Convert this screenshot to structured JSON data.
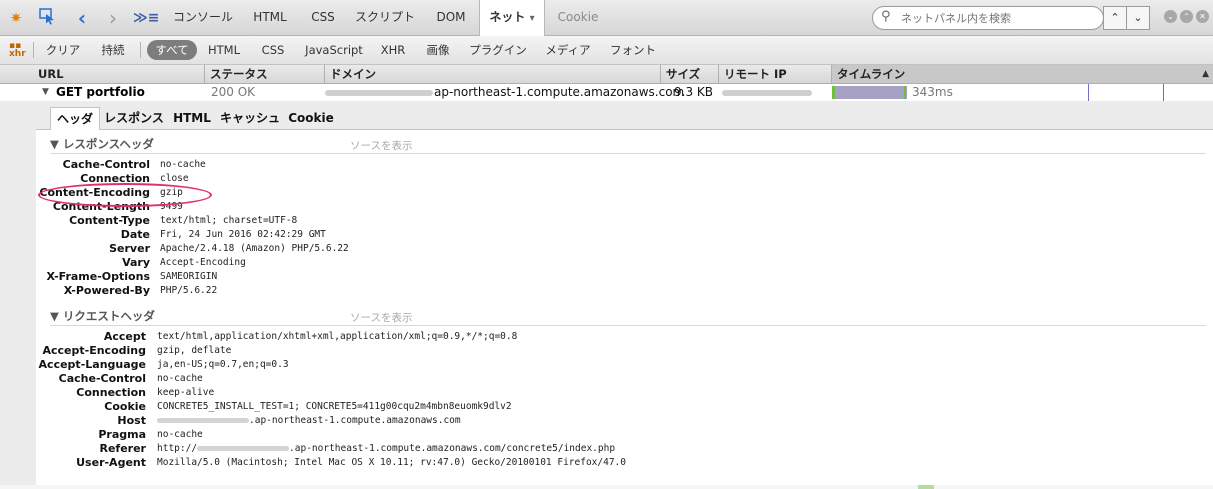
{
  "toolbar": {
    "tabs": [
      "コンソール",
      "HTML",
      "CSS",
      "スクリプト",
      "DOM",
      "ネット",
      "Cookie"
    ],
    "active_tab": "ネット",
    "active_tab_arrow": "▾",
    "search_placeholder": "ネットパネル内を検索",
    "icons": [
      "firebug-icon",
      "inspect-icon",
      "back-icon",
      "forward-icon",
      "command-line-icon",
      "search-icon"
    ]
  },
  "filters": {
    "clear": "クリア",
    "persist": "持続",
    "items": [
      "すべて",
      "HTML",
      "CSS",
      "JavaScript",
      "XHR",
      "画像",
      "プラグイン",
      "メディア",
      "フォント"
    ],
    "active": "すべて"
  },
  "columns": {
    "url": "URL",
    "status": "ステータス",
    "domain": "ドメイン",
    "size": "サイズ",
    "remote_ip": "リモート IP",
    "timeline": "タイムライン"
  },
  "request": {
    "name": "GET portfolio",
    "status": "200 OK",
    "domain": "ap-northeast-1.compute.amazonaws.com",
    "size": "9.3 KB",
    "time": "343ms"
  },
  "subtabs": [
    "ヘッダ",
    "レスポンス",
    "HTML",
    "キャッシュ",
    "Cookie"
  ],
  "view_source": "ソースを表示",
  "response_headers": {
    "title": "レスポンスヘッダ",
    "rows": [
      {
        "name": "Cache-Control",
        "value": "no-cache"
      },
      {
        "name": "Connection",
        "value": "close"
      },
      {
        "name": "Content-Encoding",
        "value": "gzip"
      },
      {
        "name": "Content-Length",
        "value": "9499"
      },
      {
        "name": "Content-Type",
        "value": "text/html; charset=UTF-8"
      },
      {
        "name": "Date",
        "value": "Fri, 24 Jun 2016 02:42:29 GMT"
      },
      {
        "name": "Server",
        "value": "Apache/2.4.18 (Amazon) PHP/5.6.22"
      },
      {
        "name": "Vary",
        "value": "Accept-Encoding"
      },
      {
        "name": "X-Frame-Options",
        "value": "SAMEORIGIN"
      },
      {
        "name": "X-Powered-By",
        "value": "PHP/5.6.22"
      }
    ]
  },
  "request_headers": {
    "title": "リクエストヘッダ",
    "rows": [
      {
        "name": "Accept",
        "value": "text/html,application/xhtml+xml,application/xml;q=0.9,*/*;q=0.8"
      },
      {
        "name": "Accept-Encoding",
        "value": "gzip, deflate"
      },
      {
        "name": "Accept-Language",
        "value": "ja,en-US;q=0.7,en;q=0.3"
      },
      {
        "name": "Cache-Control",
        "value": "no-cache"
      },
      {
        "name": "Connection",
        "value": "keep-alive"
      },
      {
        "name": "Cookie",
        "value": "CONCRETE5_INSTALL_TEST=1; CONCRETE5=411g00cqu2m4mbn8euomk9dlv2"
      },
      {
        "name": "Host",
        "value": ".ap-northeast-1.compute.amazonaws.com",
        "blur_prefix": true
      },
      {
        "name": "Pragma",
        "value": "no-cache"
      },
      {
        "name": "Referer",
        "value": ".ap-northeast-1.compute.amazonaws.com/concrete5/index.php",
        "prefix": "http://",
        "blur_prefix": true
      },
      {
        "name": "User-Agent",
        "value": "Mozilla/5.0 (Macintosh; Intel Mac OS X 10.11; rv:47.0) Gecko/20100101 Firefox/47.0"
      }
    ]
  },
  "highlight_color": "#e0306a",
  "timeline_colors": {
    "waiting": "#a5a0c4",
    "connect": "#6fbf3f"
  }
}
